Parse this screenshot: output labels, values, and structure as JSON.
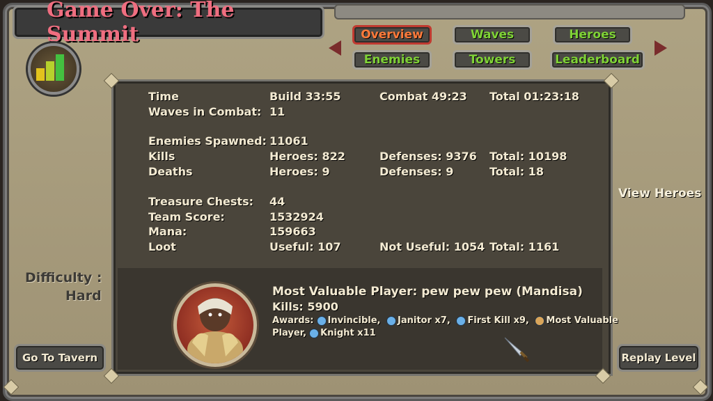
{
  "header": {
    "title": "Game Over: The Summit"
  },
  "tabs": [
    {
      "label": "Overview",
      "active": true
    },
    {
      "label": "Waves",
      "active": false
    },
    {
      "label": "Heroes",
      "active": false
    },
    {
      "label": "Enemies",
      "active": false
    },
    {
      "label": "Towers",
      "active": false
    },
    {
      "label": "Leaderboard",
      "active": false
    }
  ],
  "stats": {
    "time": {
      "label": "Time",
      "build": "Build 33:55",
      "combat": "Combat 49:23",
      "total": "Total 01:23:18"
    },
    "waves": {
      "label": "Waves in Combat:",
      "value": "11"
    },
    "enemies": {
      "label": "Enemies Spawned:",
      "value": "11061"
    },
    "kills": {
      "label": "Kills",
      "heroes": "Heroes: 822",
      "defenses": "Defenses: 9376",
      "total": "Total: 10198"
    },
    "deaths": {
      "label": "Deaths",
      "heroes": "Heroes: 9",
      "defenses": "Defenses: 9",
      "total": "Total: 18"
    },
    "chests": {
      "label": "Treasure Chests:",
      "value": "44"
    },
    "score": {
      "label": "Team Score:",
      "value": "1532924"
    },
    "mana": {
      "label": "Mana:",
      "value": "159663"
    },
    "loot": {
      "label": "Loot",
      "useful": "Useful: 107",
      "not_useful": "Not Useful: 1054",
      "total": "Total: 1161"
    }
  },
  "mvp": {
    "title": "Most Valuable Player: pew pew pew (Mandisa)",
    "kills": "Kills: 5900",
    "awards_label": "Awards:",
    "award1": "Invincible,",
    "award2": "Janitor x7,",
    "award3": "First Kill x9,",
    "award4": "Most Valuable",
    "award4b": "Player,",
    "award5": "Knight x11"
  },
  "side": {
    "view_heroes": "View Heroes",
    "difficulty_label": "Difficulty :",
    "difficulty_value": "Hard",
    "tavern_button": "Go To Tavern",
    "replay_button": "Replay Level"
  },
  "colors": {
    "tab_text": "#7fd236",
    "tab_active": "#ff7a3a",
    "title": "#ef6e80"
  }
}
